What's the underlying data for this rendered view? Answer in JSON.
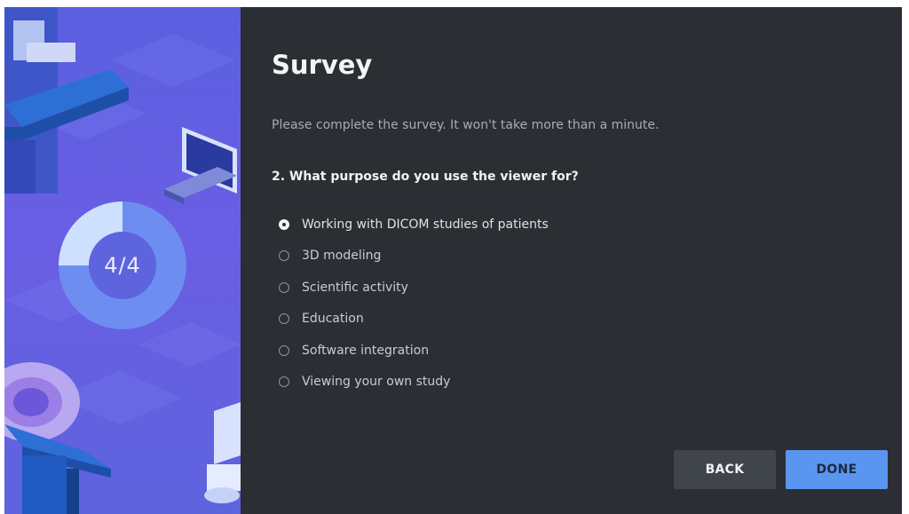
{
  "illustration": {
    "progress_label": "4/4"
  },
  "survey": {
    "title": "Survey",
    "subtitle": "Please complete the survey. It won't take more than a minute.",
    "question": "2. What purpose do you use the viewer for?",
    "selected_index": 0,
    "options": [
      {
        "label": "Working with DICOM studies of patients"
      },
      {
        "label": "3D modeling"
      },
      {
        "label": "Scientific activity"
      },
      {
        "label": "Education"
      },
      {
        "label": "Software integration"
      },
      {
        "label": "Viewing your own study"
      }
    ]
  },
  "buttons": {
    "back_label": "BACK",
    "done_label": "DONE"
  },
  "colors": {
    "panel_background": "#2b2e33",
    "accent_button": "#5a95ef",
    "secondary_button": "#40444b",
    "illustration_background": "#5e63de"
  }
}
